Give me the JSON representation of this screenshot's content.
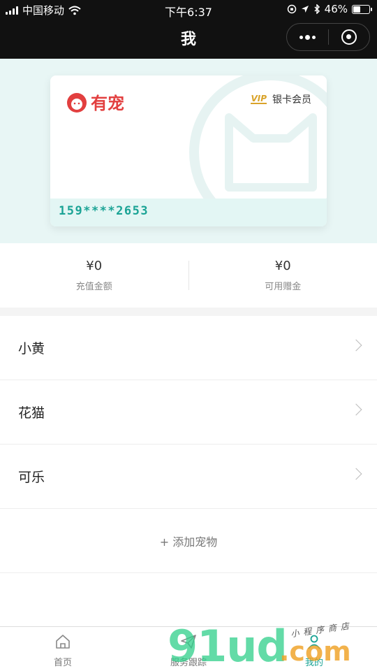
{
  "status_bar": {
    "carrier": "中国移动",
    "time": "下午6:37",
    "battery": "46%",
    "battery_level": 0.46
  },
  "nav": {
    "title": "我"
  },
  "card": {
    "brand": "有宠",
    "vip_badge": "VIP",
    "tier": "银卡会员",
    "number": "159****2653"
  },
  "balance": {
    "recharge_amount": "¥0",
    "recharge_label": "充值金额",
    "bonus_amount": "¥0",
    "bonus_label": "可用赠金"
  },
  "pets": [
    {
      "name": "小黄"
    },
    {
      "name": "花猫"
    },
    {
      "name": "可乐"
    }
  ],
  "add_pet_label": "+ 添加宠物",
  "tabs": [
    {
      "label": "首页",
      "icon": "home-icon"
    },
    {
      "label": "服务跟踪",
      "icon": "paper-plane-icon"
    },
    {
      "label": "我的",
      "icon": "user-icon",
      "active": true
    }
  ],
  "watermark": {
    "main": "91ud",
    "suffix": ".com",
    "subtitle": "小程序商店"
  },
  "colors": {
    "accent": "#1aa395",
    "brand_red": "#e23f3f",
    "vip_gold": "#d9a32a",
    "card_bg": "#e8f6f5"
  }
}
